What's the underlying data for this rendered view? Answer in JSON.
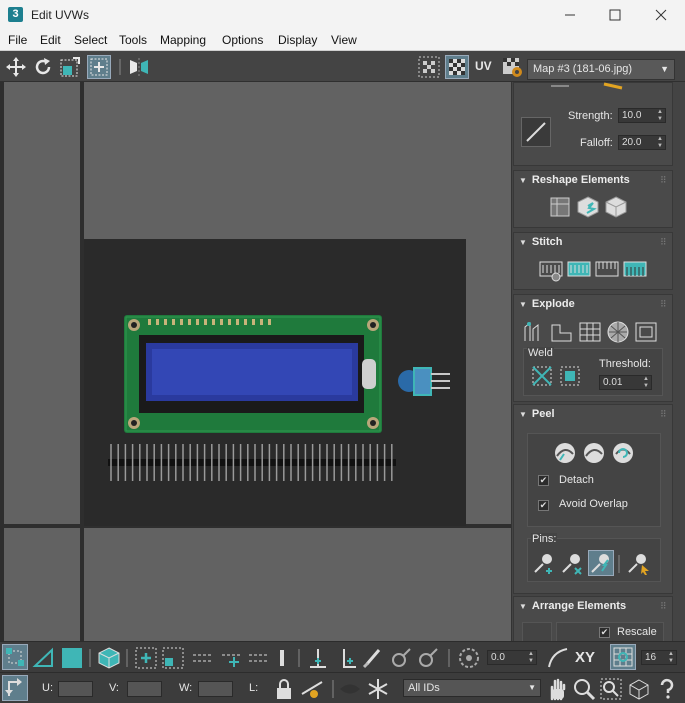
{
  "window": {
    "title": "Edit UVWs",
    "app_icon_label": "3"
  },
  "menu": [
    "File",
    "Edit",
    "Select",
    "Tools",
    "Mapping",
    "Options",
    "Display",
    "View"
  ],
  "toolbar": {
    "uv_label": "UV",
    "map_selector": "Map #3 (181-06.jpg)"
  },
  "panel": {
    "soft_select": {
      "strength_label": "Strength:",
      "strength_value": "10.0",
      "falloff_label": "Falloff:",
      "falloff_value": "20.0"
    },
    "reshape": {
      "title": "Reshape Elements"
    },
    "stitch": {
      "title": "Stitch"
    },
    "explode": {
      "title": "Explode",
      "weld_label": "Weld",
      "threshold_label": "Threshold:",
      "threshold_value": "0.01"
    },
    "peel": {
      "title": "Peel",
      "detach_label": "Detach",
      "detach_checked": true,
      "avoid_overlap_label": "Avoid Overlap",
      "avoid_overlap_checked": true,
      "pins_label": "Pins:"
    },
    "arrange": {
      "title": "Arrange Elements",
      "rescale_label": "Rescale",
      "rescale_checked": true
    }
  },
  "bottom": {
    "angle_value": "0.0",
    "xy_label": "XY",
    "grid_value": "16",
    "u_label": "U:",
    "v_label": "V:",
    "w_label": "W:",
    "l_label": "L:",
    "id_filter": "All IDs"
  },
  "colors": {
    "accent": "#3fb6b6",
    "bg": "#444444",
    "viewport": "#626262",
    "grid": "#2e2e2e"
  }
}
